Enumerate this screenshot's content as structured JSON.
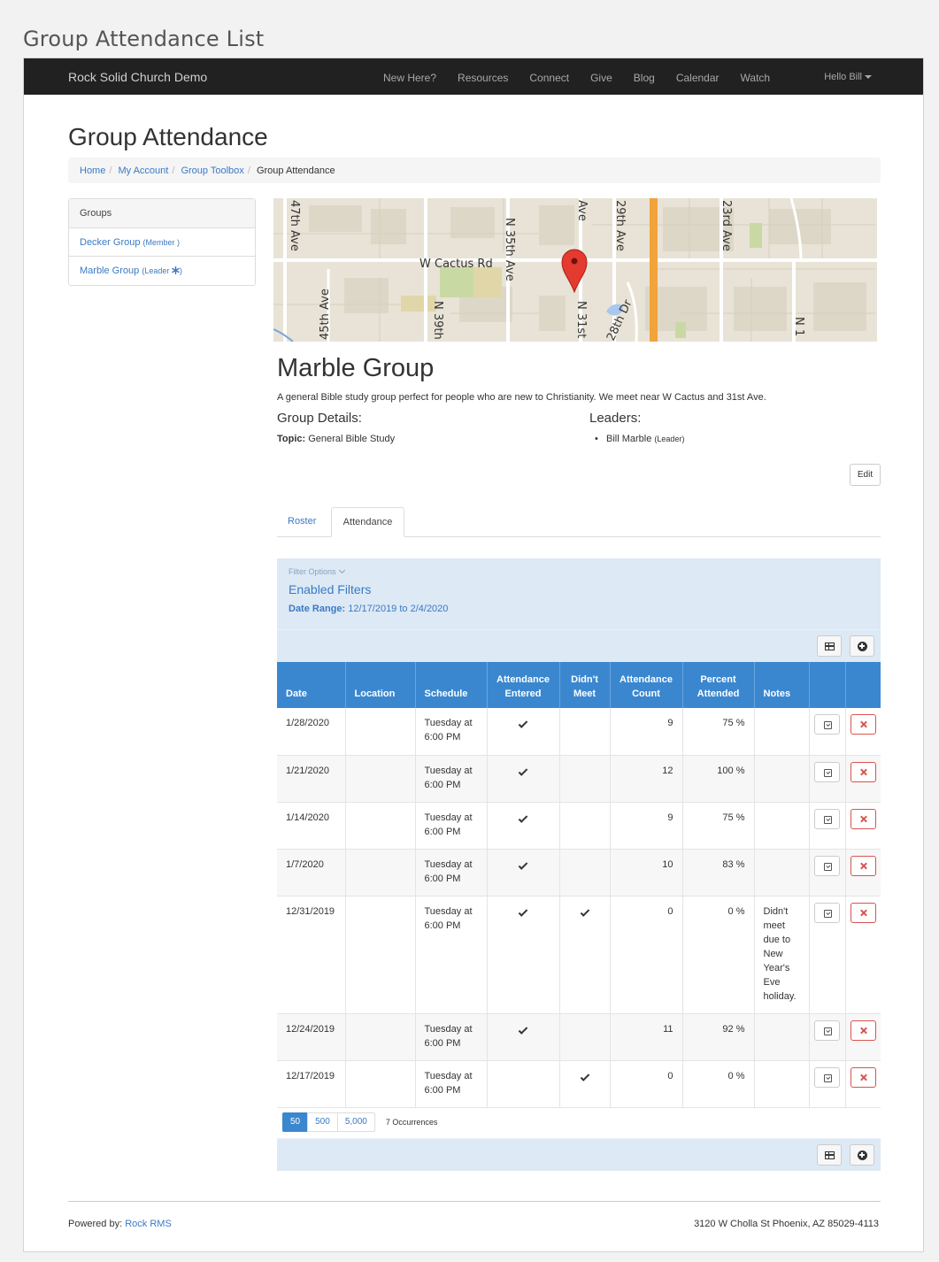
{
  "document_title": "Group Attendance List",
  "navbar": {
    "brand": "Rock Solid Church Demo",
    "items": [
      "New Here?",
      "Resources",
      "Connect",
      "Give",
      "Blog",
      "Calendar",
      "Watch"
    ],
    "user_menu": "Hello Bill"
  },
  "page_title": "Group Attendance",
  "breadcrumb": [
    "Home",
    "My Account",
    "Group Toolbox",
    "Group Attendance"
  ],
  "groups_panel": {
    "heading": "Groups",
    "items": [
      {
        "name": "Decker Group",
        "role": "(Member )"
      },
      {
        "name": "Marble Group",
        "role": "(Leader ",
        "role_suffix": ")"
      }
    ]
  },
  "map": {
    "labels": [
      "W Cactus Rd",
      "47th Ave",
      "N 35th Ave",
      "Ave",
      "29th Ave",
      "23rd Ave",
      "45th Ave",
      "N 39th",
      "N 31st",
      "28th Dr",
      "N 1"
    ]
  },
  "group": {
    "name": "Marble Group",
    "description": "A general Bible study group perfect for people who are new to Christianity. We meet near W Cactus and 31st Ave.",
    "details_heading": "Group Details:",
    "leaders_heading": "Leaders:",
    "topic_label": "Topic:",
    "topic_value": "General Bible Study",
    "leader_name": "Bill Marble",
    "leader_role": "(Leader)",
    "edit_label": "Edit"
  },
  "tabs": [
    "Roster",
    "Attendance"
  ],
  "filter": {
    "options_label": "Filter Options",
    "enabled_label": "Enabled Filters",
    "date_range_label": "Date Range:",
    "date_range_value": "12/17/2019 to 2/4/2020"
  },
  "table": {
    "headers": {
      "date": "Date",
      "location": "Location",
      "schedule": "Schedule",
      "entered_1": "Attendance",
      "entered_2": "Entered",
      "didnt_1": "Didn't",
      "didnt_2": "Meet",
      "count_1": "Attendance",
      "count_2": "Count",
      "percent_1": "Percent",
      "percent_2": "Attended",
      "notes": "Notes"
    },
    "rows": [
      {
        "date": "1/28/2020",
        "location": "",
        "schedule_1": "Tuesday at",
        "schedule_2": "6:00 PM",
        "entered": true,
        "didnt_meet": false,
        "count": "9",
        "percent": "75 %",
        "notes": ""
      },
      {
        "date": "1/21/2020",
        "location": "",
        "schedule_1": "Tuesday at",
        "schedule_2": "6:00 PM",
        "entered": true,
        "didnt_meet": false,
        "count": "12",
        "percent": "100 %",
        "notes": ""
      },
      {
        "date": "1/14/2020",
        "location": "",
        "schedule_1": "Tuesday at",
        "schedule_2": "6:00 PM",
        "entered": true,
        "didnt_meet": false,
        "count": "9",
        "percent": "75 %",
        "notes": ""
      },
      {
        "date": "1/7/2020",
        "location": "",
        "schedule_1": "Tuesday at",
        "schedule_2": "6:00 PM",
        "entered": true,
        "didnt_meet": false,
        "count": "10",
        "percent": "83 %",
        "notes": ""
      },
      {
        "date": "12/31/2019",
        "location": "",
        "schedule_1": "Tuesday at",
        "schedule_2": "6:00 PM",
        "entered": true,
        "didnt_meet": true,
        "count": "0",
        "percent": "0 %",
        "notes": "Didn't meet due to New Year's Eve holiday."
      },
      {
        "date": "12/24/2019",
        "location": "",
        "schedule_1": "Tuesday at",
        "schedule_2": "6:00 PM",
        "entered": true,
        "didnt_meet": false,
        "count": "11",
        "percent": "92 %",
        "notes": ""
      },
      {
        "date": "12/17/2019",
        "location": "",
        "schedule_1": "Tuesday at",
        "schedule_2": "6:00 PM",
        "entered": false,
        "didnt_meet": true,
        "count": "0",
        "percent": "0 %",
        "notes": ""
      }
    ]
  },
  "pager": {
    "sizes": [
      "50",
      "500",
      "5,000"
    ],
    "occurrences": "7 Occurrences"
  },
  "footer": {
    "powered_label": "Powered by:",
    "powered_link": "Rock RMS",
    "address": "3120 W Cholla St Phoenix, AZ 85029-4113"
  },
  "colors": {
    "navbar": "#212121",
    "header_blue": "#3b87cf",
    "filter_bg": "#dde9f4",
    "link": "#3a7ac4",
    "delete_red": "#d9534f"
  }
}
